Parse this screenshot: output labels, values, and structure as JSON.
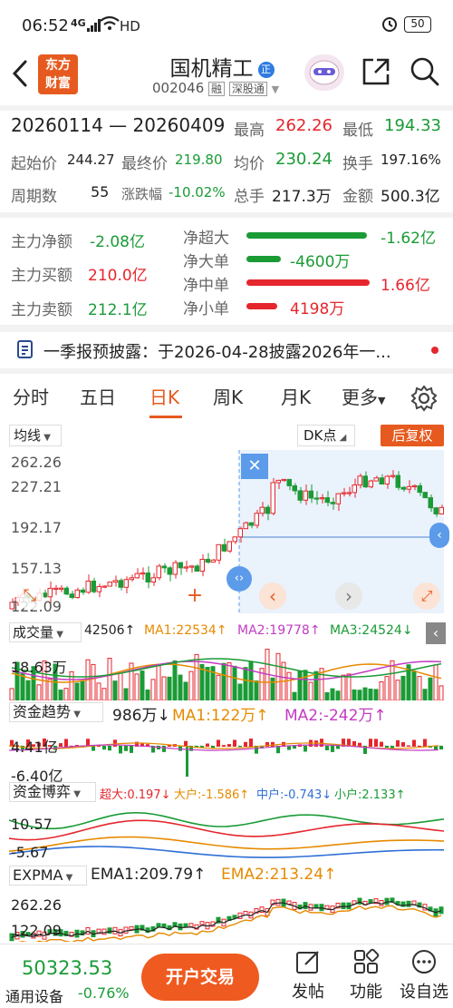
{
  "status_bar": {
    "time": "06:52",
    "net_label": "4G",
    "hd": "HD",
    "battery": "50"
  },
  "header": {
    "logo_line1": "东方",
    "logo_line2": "财富",
    "title": "国机精工",
    "badge": "正",
    "code": "002046",
    "tag_rong": "融",
    "tag_sgt": "深股通"
  },
  "period": {
    "range": "20260114 — 20260409",
    "high_label": "最高",
    "high": "262.26",
    "low_label": "最低",
    "low": "194.33",
    "open_label": "起始价",
    "open": "244.27",
    "close_label": "最终价",
    "close": "219.80",
    "avg_label": "均价",
    "avg": "230.24",
    "turnover_label": "换手",
    "turnover": "197.16%",
    "days_label": "周期数",
    "days": "55",
    "change_label": "涨跌幅",
    "change": "-10.02%",
    "volume_label": "总手",
    "volume": "217.3万",
    "amount_label": "金额",
    "amount": "500.3亿"
  },
  "flows": {
    "main_net_label": "主力净额",
    "main_net": "-2.08亿",
    "main_buy_label": "主力买额",
    "main_buy": "210.0亿",
    "main_sell_label": "主力卖额",
    "main_sell": "212.1亿",
    "rows": [
      {
        "label": "净超大",
        "value": "-1.62亿",
        "dir": "neg",
        "ratio": 0.98
      },
      {
        "label": "净大单",
        "value": "-4600万",
        "dir": "neg",
        "ratio": 0.28
      },
      {
        "label": "净中单",
        "value": "1.66亿",
        "dir": "pos",
        "ratio": 1.0
      },
      {
        "label": "净小单",
        "value": "4198万",
        "dir": "pos",
        "ratio": 0.25
      }
    ]
  },
  "notice": {
    "text": "一季报预披露：于2026-04-28披露2026年一..."
  },
  "tabs": [
    "分时",
    "五日",
    "日K",
    "周K",
    "月K",
    "更多"
  ],
  "active_tab": "日K",
  "kline": {
    "ma_select": "均线",
    "dk_label": "DK点",
    "fq_label": "后复权",
    "y_labels": [
      "262.26",
      "227.21",
      "192.17",
      "157.13",
      "122.09"
    ]
  },
  "volume": {
    "name": "成交量",
    "value": "42506↑",
    "ma1": "MA1:22534↑",
    "ma2": "MA2:19778↑",
    "ma3": "MA3:24524↓",
    "y_label": "18.63万"
  },
  "fund_trend": {
    "name": "资金趋势",
    "value": "986万↓",
    "ma1": "MA1:122万↑",
    "ma2": "MA2:-242万↑",
    "y_top": "4.41亿",
    "y_bottom": "-6.40亿"
  },
  "fund_game": {
    "name": "资金博弈",
    "xl": "超大:0.197↓",
    "l": "大户:-1.586↑",
    "m": "中户:-0.743↓",
    "s": "小户:2.133↑",
    "y_top": "10.57",
    "y_bottom": "-5.67"
  },
  "expma": {
    "name": "EXPMA",
    "ema1": "EMA1:209.79↑",
    "ema2": "EMA2:213.24↑",
    "y_top": "262.26",
    "y_bottom": "122.09"
  },
  "bottom": {
    "index_value": "50323.53",
    "index_name": "通用设备",
    "index_change": "-0.76%",
    "trade_btn": "开户交易",
    "post": "发帖",
    "func": "功能",
    "watch": "设自选"
  },
  "colors": {
    "up": "#e5262d",
    "down": "#1a9b36",
    "accent": "#e65a1f"
  }
}
